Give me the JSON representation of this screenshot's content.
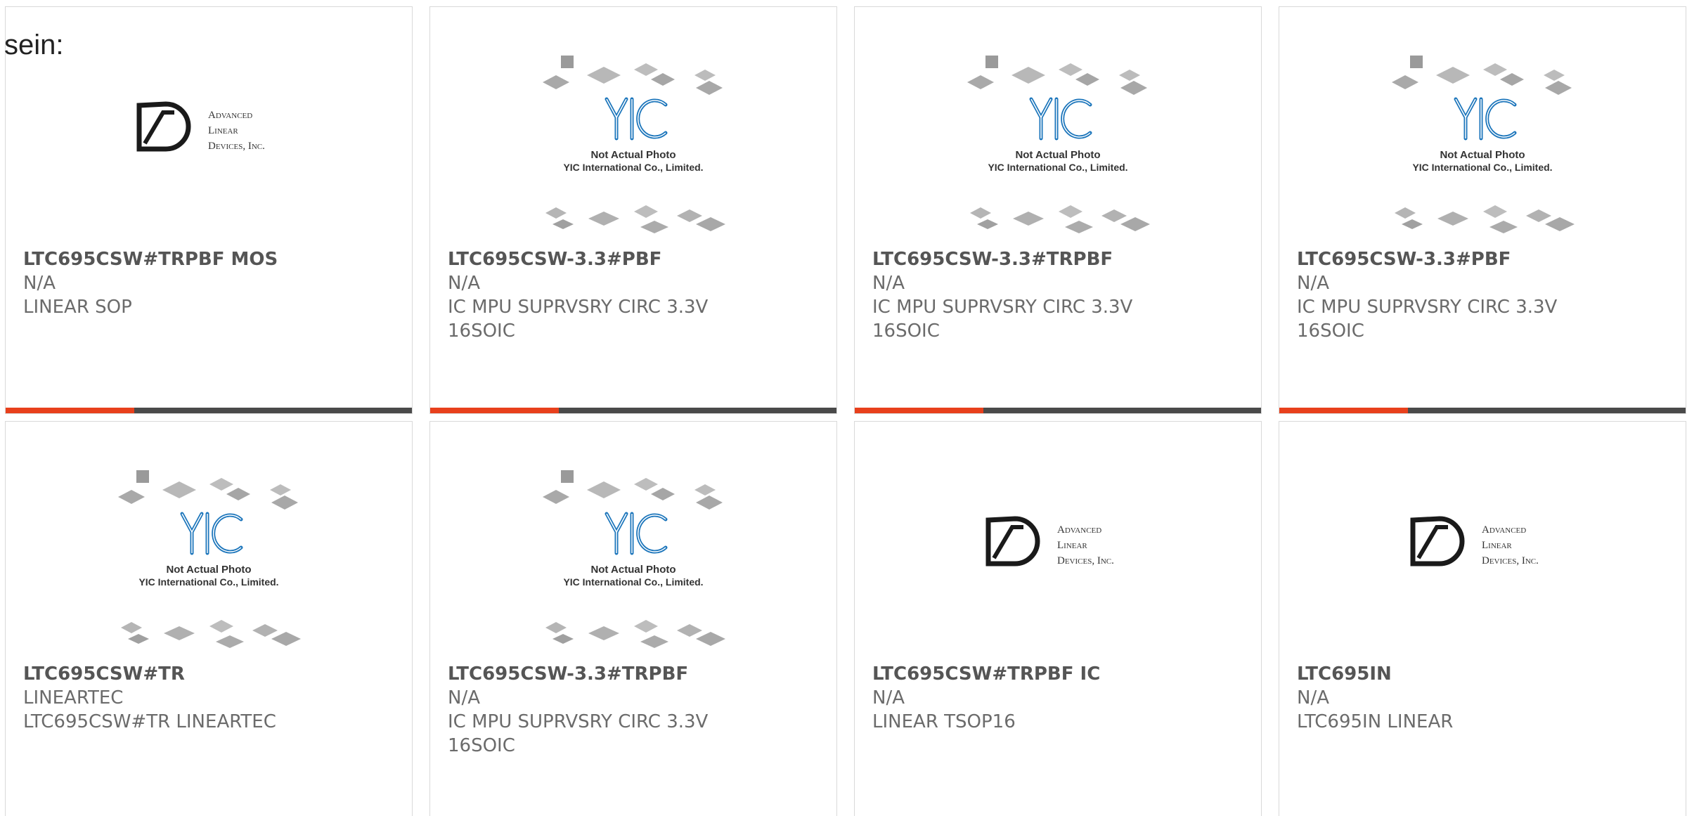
{
  "intro_text": "sein:",
  "colors": {
    "accent": "#e8401c",
    "bar": "#4a4a4a",
    "yic_blue": "#1b75bb"
  },
  "placeholders": {
    "yic": {
      "line1": "Not Actual Photo",
      "line2": "YIC International Co., Limited."
    },
    "adi": {
      "line1": "Advanced",
      "line2": "Linear",
      "line3": "Devices, Inc."
    }
  },
  "products": [
    {
      "image": "adi-logo",
      "part": "LTC695CSW#TRPBF MOS",
      "mfr": "N/A",
      "desc1": "LINEAR SOP",
      "desc2": ""
    },
    {
      "image": "yic-photo",
      "part": "LTC695CSW-3.3#PBF",
      "mfr": "N/A",
      "desc1": "IC MPU SUPRVSRY CIRC 3.3V",
      "desc2": "16SOIC"
    },
    {
      "image": "yic-photo",
      "part": "LTC695CSW-3.3#TRPBF",
      "mfr": "N/A",
      "desc1": "IC MPU SUPRVSRY CIRC 3.3V",
      "desc2": "16SOIC"
    },
    {
      "image": "yic-photo",
      "part": "LTC695CSW-3.3#PBF",
      "mfr": "N/A",
      "desc1": "IC MPU SUPRVSRY CIRC 3.3V",
      "desc2": "16SOIC"
    },
    {
      "image": "yic-photo",
      "part": "LTC695CSW#TR",
      "mfr": "LINEARTEC",
      "desc1": "LTC695CSW#TR LINEARTEC",
      "desc2": ""
    },
    {
      "image": "yic-photo",
      "part": "LTC695CSW-3.3#TRPBF",
      "mfr": "N/A",
      "desc1": "IC MPU SUPRVSRY CIRC 3.3V",
      "desc2": "16SOIC"
    },
    {
      "image": "adi-logo",
      "part": "LTC695CSW#TRPBF IC",
      "mfr": "N/A",
      "desc1": "LINEAR TSOP16",
      "desc2": ""
    },
    {
      "image": "adi-logo",
      "part": "LTC695IN",
      "mfr": "N/A",
      "desc1": "LTC695IN LINEAR",
      "desc2": ""
    }
  ]
}
